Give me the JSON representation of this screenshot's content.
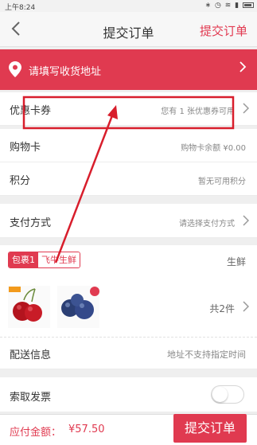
{
  "status_bar": {
    "time": "上午8:24",
    "icons": [
      "bluetooth-icon",
      "alarm-icon",
      "wifi-icon",
      "signal-icon",
      "battery-icon"
    ]
  },
  "nav": {
    "back_icon": "chevron-left-icon",
    "title": "提交订单",
    "action": "提交订单"
  },
  "address": {
    "label": "请填写收货地址",
    "icon": "location-pin-icon"
  },
  "coupon": {
    "label": "优惠卡券",
    "value": "您有 1 张优惠券可用"
  },
  "shopping_card": {
    "label": "购物卡",
    "value": "购物卡余额 ¥0.00"
  },
  "points": {
    "label": "积分",
    "value": "暂无可用积分"
  },
  "payment": {
    "label": "支付方式",
    "value": "请选择支付方式"
  },
  "package": {
    "tag": "包裹1",
    "store": "飞牛生鲜",
    "category": "生鲜",
    "count": "共2件",
    "products": [
      "cherries",
      "blueberries"
    ]
  },
  "delivery": {
    "label": "配送信息",
    "value": "地址不支持指定时间"
  },
  "invoice": {
    "label": "索取发票",
    "enabled": false
  },
  "footer": {
    "total_label": "应付金额：",
    "total_amount": "¥57.50",
    "submit": "提交订单"
  },
  "colors": {
    "accent": "#e03a50",
    "annotation": "#d81e2c"
  }
}
